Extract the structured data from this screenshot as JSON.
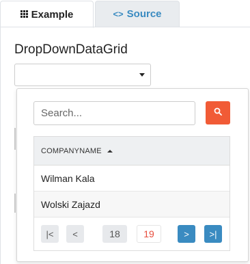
{
  "tabs": [
    {
      "label": "Example",
      "icon": "grid-icon",
      "active": true
    },
    {
      "label": "Source",
      "icon": "code-icon",
      "active": false
    }
  ],
  "component_title": "DropDownDataGrid",
  "dropdown": {
    "value": ""
  },
  "search": {
    "placeholder": "Search...",
    "value": ""
  },
  "grid": {
    "column_header": "COMPANYNAME",
    "sort_direction": "ascending",
    "rows": [
      "Wilman Kala",
      "Wolski Zajazd"
    ]
  },
  "pager": {
    "pages": [
      "18",
      "19"
    ],
    "current_page": "19",
    "first_glyph": "|<",
    "prev_glyph": "<",
    "next_glyph": ">",
    "last_glyph": ">|"
  },
  "colors": {
    "accent_blue": "#3a8bc1",
    "search_button": "#f15b36",
    "current_page": "#e74c3c"
  }
}
